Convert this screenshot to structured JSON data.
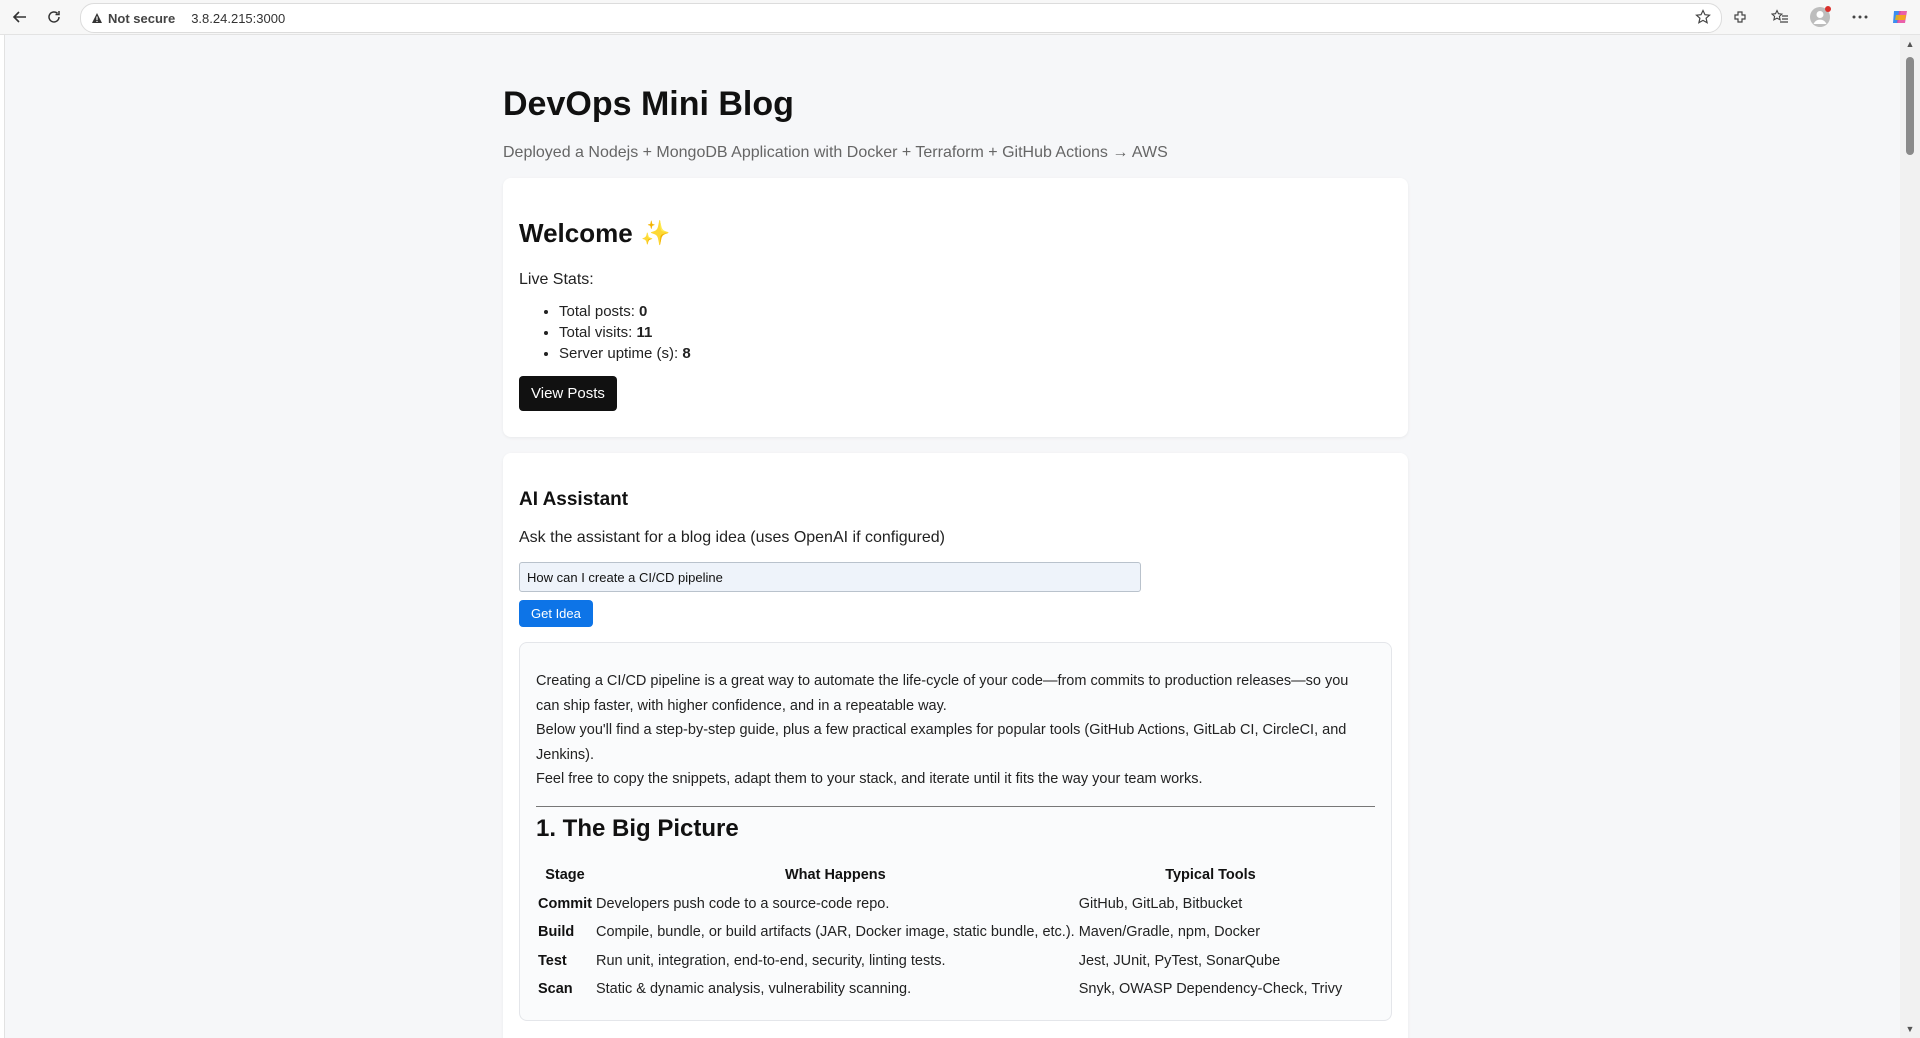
{
  "browser": {
    "security_label": "Not secure",
    "url": "3.8.24.215:3000"
  },
  "page": {
    "title": "DevOps Mini Blog",
    "subtitle": "Deployed a Nodejs + MongoDB Application with Docker + Terraform + GitHub Actions → AWS"
  },
  "welcome": {
    "heading": "Welcome",
    "emoji": "✨",
    "live_stats_label": "Live Stats:",
    "stats": [
      {
        "label": "Total posts: ",
        "value": "0"
      },
      {
        "label": "Total visits: ",
        "value": "11"
      },
      {
        "label": "Server uptime (s): ",
        "value": "8"
      }
    ],
    "view_posts_label": "View Posts"
  },
  "assistant": {
    "heading": "AI Assistant",
    "description": "Ask the assistant for a blog idea (uses OpenAI if configured)",
    "input_value": "How can I create a CI/CD pipeline",
    "button_label": "Get Idea",
    "answer": {
      "para1": "Creating a CI/CD pipeline is a great way to automate the life-cycle of your code—from commits to production releases—so you can ship faster, with higher confidence, and in a repeatable way.",
      "para2": "Below you'll find a step-by-step guide, plus a few practical examples for popular tools (GitHub Actions, GitLab CI, CircleCI, and Jenkins).",
      "para3": "Feel free to copy the snippets, adapt them to your stack, and iterate until it fits the way your team works.",
      "section_heading": "1. The Big Picture",
      "table": {
        "headers": [
          "Stage",
          "What Happens",
          "Typical Tools"
        ],
        "rows": [
          {
            "stage": "Commit",
            "what": "Developers push code to a source-code repo.",
            "tools": "GitHub, GitLab, Bitbucket"
          },
          {
            "stage": "Build",
            "what": "Compile, bundle, or build artifacts (JAR, Docker image, static bundle, etc.).",
            "tools": "Maven/Gradle, npm, Docker"
          },
          {
            "stage": "Test",
            "what": "Run unit, integration, end-to-end, security, linting tests.",
            "tools": "Jest, JUnit, PyTest, SonarQube"
          },
          {
            "stage": "Scan",
            "what": "Static & dynamic analysis, vulnerability scanning.",
            "tools": "Snyk, OWASP Dependency-Check, Trivy"
          }
        ]
      }
    }
  }
}
